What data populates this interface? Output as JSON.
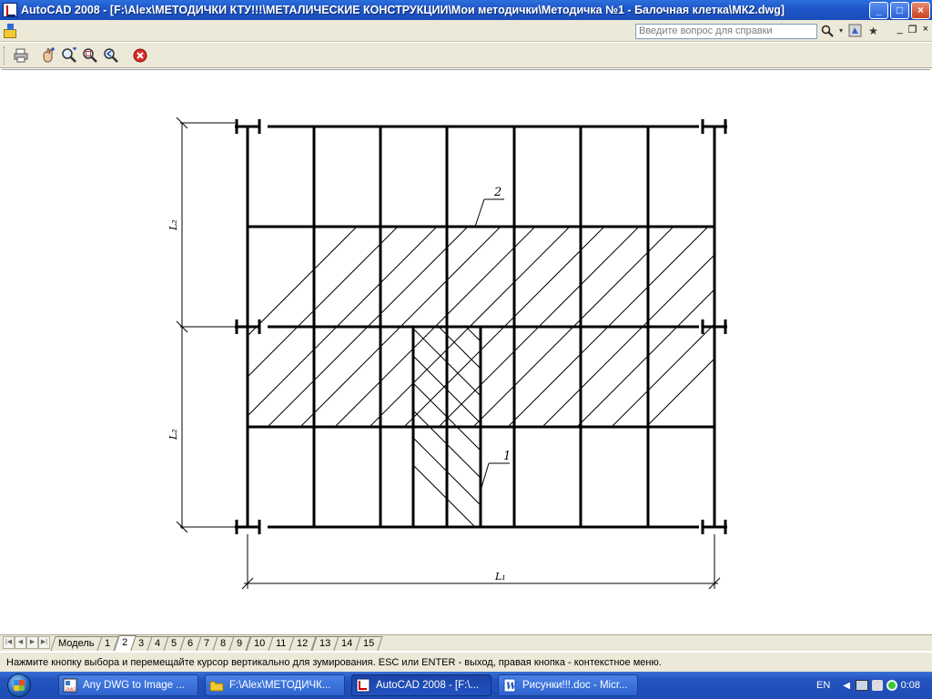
{
  "window": {
    "title": "AutoCAD 2008 - [F:\\Alex\\МЕТОДИЧКИ КТУ!!!\\МЕТАЛИЧЕСКИЕ КОНСТРУКЦИИ\\Мои методички\\Методичка №1 - Балочная клетка\\МК2.dwg]",
    "buttons": {
      "minimize": "_",
      "maximize": "□",
      "close": "×"
    }
  },
  "menubar": {
    "help_placeholder": "Введите вопрос для справки",
    "mdi": {
      "minimize": "_",
      "restore": "❐",
      "close": "×"
    }
  },
  "toolbar": {
    "buttons": [
      "plot-icon",
      "pan-realtime-icon",
      "zoom-realtime-icon",
      "zoom-window-icon",
      "zoom-previous-icon",
      "close-preview-icon"
    ]
  },
  "drawing": {
    "labels": {
      "L1": "L₁",
      "L2a": "L₂",
      "L2b": "L₂",
      "callout1": "1",
      "callout2": "2"
    }
  },
  "layout_tabs": [
    "Модель",
    "1",
    "2",
    "3",
    "4",
    "5",
    "6",
    "7",
    "8",
    "9",
    "10",
    "11",
    "12",
    "13",
    "14",
    "15"
  ],
  "active_tab": "2",
  "status": {
    "prompt": "Нажмите кнопку выбора и перемещайте курсор вертикально для зумирования. ESC или ENTER - выход, правая кнопка - контекстное меню."
  },
  "taskbar": {
    "items": [
      {
        "label": "Any DWG to Image ...",
        "active": false
      },
      {
        "label": "F:\\Alex\\МЕТОДИЧК...",
        "active": false
      },
      {
        "label": "AutoCAD 2008 - [F:\\...",
        "active": true
      },
      {
        "label": "Рисунки!!!.doc - Micr...",
        "active": false
      }
    ],
    "language": "EN",
    "clock": "0:08"
  },
  "colors": {
    "titlebar": "#1e55c8",
    "chrome": "#ece9d8",
    "taskbar": "#2453c0"
  }
}
